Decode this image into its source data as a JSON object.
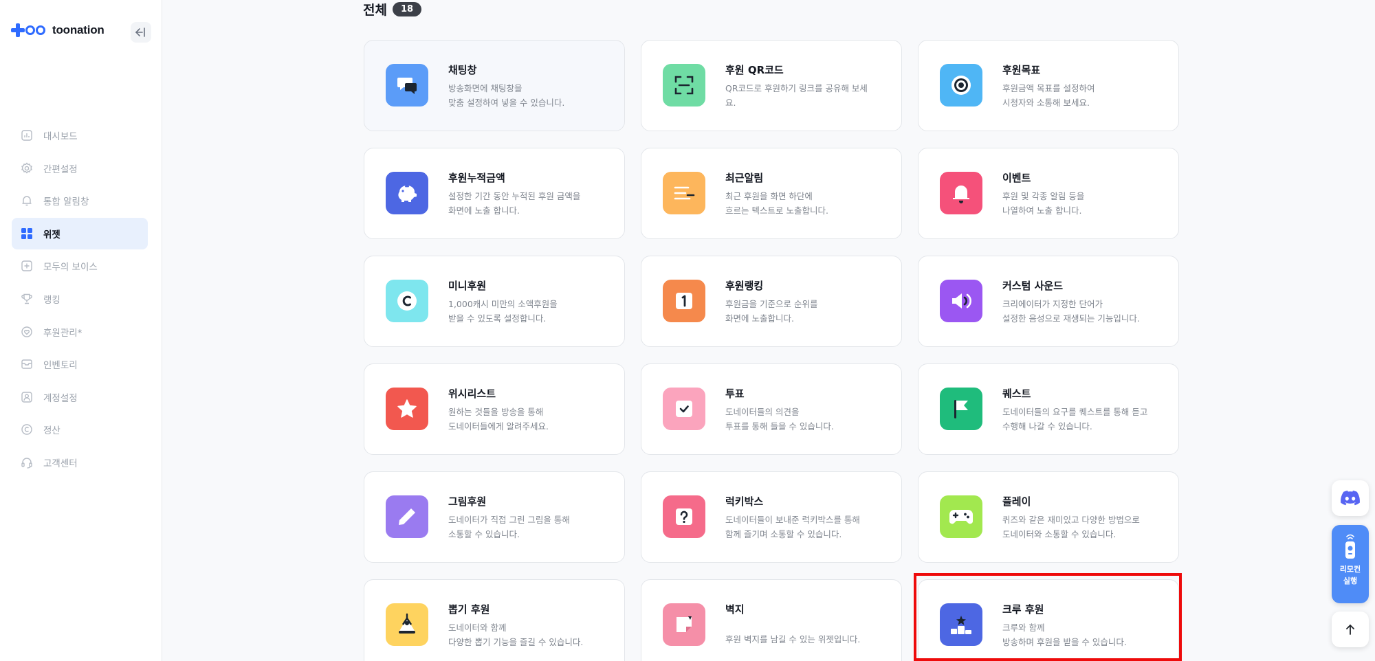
{
  "brand": {
    "name": "toonation"
  },
  "colors": {
    "accent": "#2f6bff",
    "active_nav_bg": "#e8f0fd",
    "highlight": "#ee0b0b"
  },
  "sidebar": {
    "items": [
      {
        "label": "대시보드",
        "icon": "dashboard-icon",
        "active": false
      },
      {
        "label": "간편설정",
        "icon": "gear-icon",
        "active": false
      },
      {
        "label": "통합 알림창",
        "icon": "bell-icon",
        "active": false
      },
      {
        "label": "위젯",
        "icon": "widget-grid-icon",
        "active": true
      },
      {
        "label": "모두의 보이스",
        "icon": "voice-icon",
        "active": false
      },
      {
        "label": "랭킹",
        "icon": "trophy-icon",
        "active": false
      },
      {
        "label": "후원관리*",
        "icon": "heart-icon",
        "active": false
      },
      {
        "label": "인벤토리",
        "icon": "inventory-icon",
        "active": false
      },
      {
        "label": "계정설정",
        "icon": "user-icon",
        "active": false
      },
      {
        "label": "정산",
        "icon": "copyright-icon",
        "active": false
      },
      {
        "label": "고객센터",
        "icon": "headset-icon",
        "active": false
      }
    ]
  },
  "main": {
    "heading": "전체",
    "count": "18",
    "widgets": [
      {
        "title": "채팅창",
        "desc": [
          "방송화면에 채팅창을",
          "맞춤 설정하여 넣을 수 있습니다."
        ],
        "icon": "chat-icon",
        "color": "#5b9cf8"
      },
      {
        "title": "후원 QR코드",
        "desc": [
          "QR코드로 후원하기 링크를 공유해 보세",
          "요."
        ],
        "icon": "qr-scan-icon",
        "color": "#6fdca4"
      },
      {
        "title": "후원목표",
        "desc": [
          "후원금액 목표를 설정하여",
          "시청자와 소통해 보세요."
        ],
        "icon": "target-icon",
        "color": "#4fb6f5"
      },
      {
        "title": "후원누적금액",
        "desc": [
          "설정한 기간 동안 누적된 후원 금액을",
          "화면에 노출 합니다."
        ],
        "icon": "piggy-bank-icon",
        "color": "#4d67e3"
      },
      {
        "title": "최근알림",
        "desc": [
          "최근 후원을 화면 하단에",
          "흐르는 텍스트로 노출합니다."
        ],
        "icon": "text-lines-icon",
        "color": "#fdb65c"
      },
      {
        "title": "이벤트",
        "desc": [
          "후원 및 각종 알림 등을",
          "나열하여 노출 합니다."
        ],
        "icon": "bell-icon",
        "color": "#f5517a"
      },
      {
        "title": "미니후원",
        "desc": [
          "1,000캐시 미만의 소액후원을",
          "받을 수 있도록 설정합니다."
        ],
        "icon": "coin-icon",
        "color": "#7ee6ee"
      },
      {
        "title": "후원랭킹",
        "desc": [
          "후원금을 기준으로 순위를",
          "화면에 노출합니다."
        ],
        "icon": "rank-one-icon",
        "color": "#f5894c"
      },
      {
        "title": "커스텀 사운드",
        "desc": [
          "크리에이터가 지정한 단어가",
          "설정한 음성으로 재생되는 기능입니다."
        ],
        "icon": "speaker-icon",
        "color": "#9b57f2"
      },
      {
        "title": "위시리스트",
        "desc": [
          "원하는 것들을 방송을 통해",
          "도네이터들에게 알려주세요."
        ],
        "icon": "star-icon",
        "color": "#f2584f"
      },
      {
        "title": "투표",
        "desc": [
          "도네이터들의 의견을",
          "투표를 통해 들을 수 있습니다."
        ],
        "icon": "ballot-check-icon",
        "color": "#fba4bd"
      },
      {
        "title": "퀘스트",
        "desc": [
          "도네이터들의 요구를 퀘스트를 통해 듣고",
          "수행해 나갈 수 있습니다."
        ],
        "icon": "flag-icon",
        "color": "#1fbc7c"
      },
      {
        "title": "그림후원",
        "desc": [
          "도네이터가 직접 그린 그림을 통해",
          "소통할 수 있습니다."
        ],
        "icon": "pencil-icon",
        "color": "#9a7bf0"
      },
      {
        "title": "럭키박스",
        "desc": [
          "도네이터들이 보내준 럭키박스를 통해",
          "함께 즐기며 소통할 수 있습니다."
        ],
        "icon": "question-box-icon",
        "color": "#f56b8a"
      },
      {
        "title": "플레이",
        "desc": [
          "퀴즈와 같은 재미있고 다양한 방법으로",
          "도네이터와 소통할 수 있습니다."
        ],
        "icon": "gamepad-icon",
        "color": "#a2e84f"
      },
      {
        "title": "뽑기 후원",
        "desc": [
          "도네이터와 함께",
          "다양한 뽑기 기능을 즐길 수 있습니다."
        ],
        "icon": "claw-machine-icon",
        "color": "#fed35f"
      },
      {
        "title": "벽지",
        "desc": [
          "후원 벽지를 남길 수 있는 위젯입니다."
        ],
        "icon": "sticky-note-icon",
        "color": "#f58fa8"
      },
      {
        "title": "크루 후원",
        "desc": [
          "크루와 함께",
          "방송하며 후원을 받을 수 있습니다."
        ],
        "icon": "podium-icon",
        "color": "#4d67e3"
      }
    ]
  },
  "floating": {
    "remote_label": [
      "리모컨",
      "실행"
    ]
  }
}
